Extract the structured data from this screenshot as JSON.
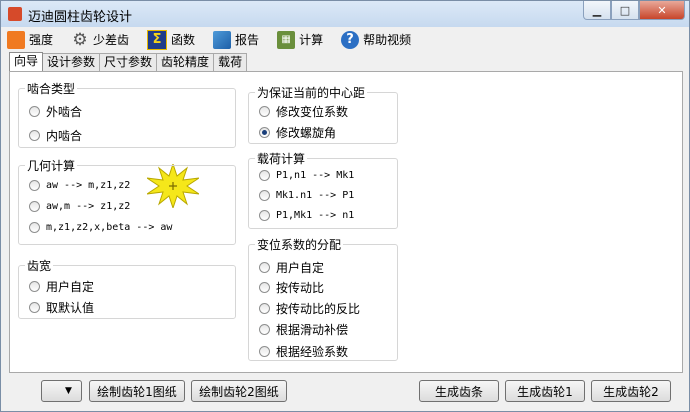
{
  "window": {
    "title": "迈迪圆柱齿轮设计"
  },
  "toolbar": [
    {
      "label": "强度",
      "icon": "strength-icon"
    },
    {
      "label": "少差齿",
      "icon": "gear-icon"
    },
    {
      "label": "函数",
      "icon": "function-icon",
      "glyph": "Σ"
    },
    {
      "label": "报告",
      "icon": "report-icon"
    },
    {
      "label": "计算",
      "icon": "calculator-icon"
    },
    {
      "label": "帮助视频",
      "icon": "help-icon",
      "glyph": "?"
    }
  ],
  "tabs": [
    "向导",
    "设计参数",
    "尺寸参数",
    "齿轮精度",
    "载荷"
  ],
  "groups": {
    "mesh": {
      "title": "啮合类型",
      "options": [
        "外啮合",
        "内啮合"
      ]
    },
    "geometry": {
      "title": "几何计算",
      "options": [
        "aw --> m,z1,z2",
        "aw,m --> z1,z2",
        "m,z1,z2,x,beta --> aw"
      ]
    },
    "width": {
      "title": "齿宽",
      "options": [
        "用户自定",
        "取默认值"
      ]
    },
    "center": {
      "title": "为保证当前的中心距",
      "options": [
        "修改变位系数",
        "修改螺旋角"
      ],
      "selected": 1
    },
    "load": {
      "title": "载荷计算",
      "options": [
        "P1,n1 --> Mk1",
        "Mk1.n1 --> P1",
        "P1,Mk1 --> n1"
      ]
    },
    "shift": {
      "title": "变位系数的分配",
      "options": [
        "用户自定",
        "按传动比",
        "按传动比的反比",
        "根据滑动补偿",
        "根据经验系数"
      ]
    }
  },
  "buttons": {
    "draw1": "绘制齿轮1图纸",
    "draw2": "绘制齿轮2图纸",
    "rack": "生成齿条",
    "gear1": "生成齿轮1",
    "gear2": "生成齿轮2"
  },
  "colors": {
    "accent_burst": "#f5e71a",
    "titlebar": "#c6d9ef",
    "close": "#c7452a"
  }
}
